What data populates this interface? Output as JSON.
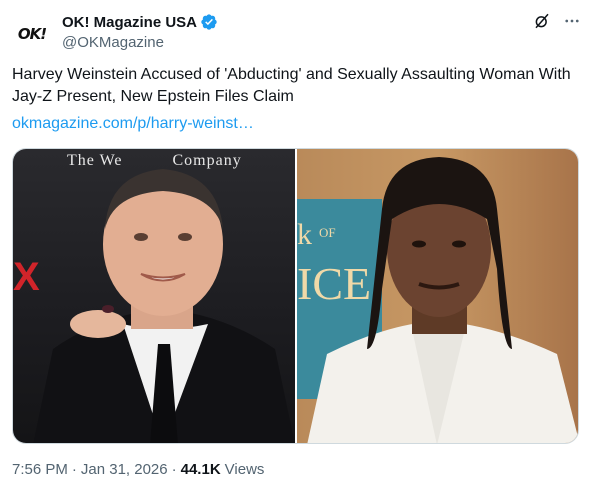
{
  "account": {
    "avatar_text": "OK!",
    "display_name": "OK! Magazine USA",
    "handle": "@OKMagazine",
    "verified_color": "#1d9bf0"
  },
  "tweet": {
    "text": "Harvey Weinstein Accused of 'Abducting' and Sexually Assaulting Woman With Jay-Z Present, New Epstein Files Claim",
    "link": "okmagazine.com/p/harry-weinst…"
  },
  "media": {
    "left_photo": {
      "banner_text": "The We          Company",
      "backdrop_letter": "X"
    },
    "right_photo": {
      "backdrop_text": "k of\nICE"
    }
  },
  "meta": {
    "time": "7:56 PM",
    "date": "Jan 31, 2026",
    "views_count": "44.1K",
    "views_label": "Views"
  },
  "icons": {
    "verified": "verified-badge-icon",
    "grok": "grok-icon",
    "more": "more-icon"
  },
  "colors": {
    "text": "#0f1419",
    "secondary": "#536471",
    "link": "#1d9bf0"
  }
}
